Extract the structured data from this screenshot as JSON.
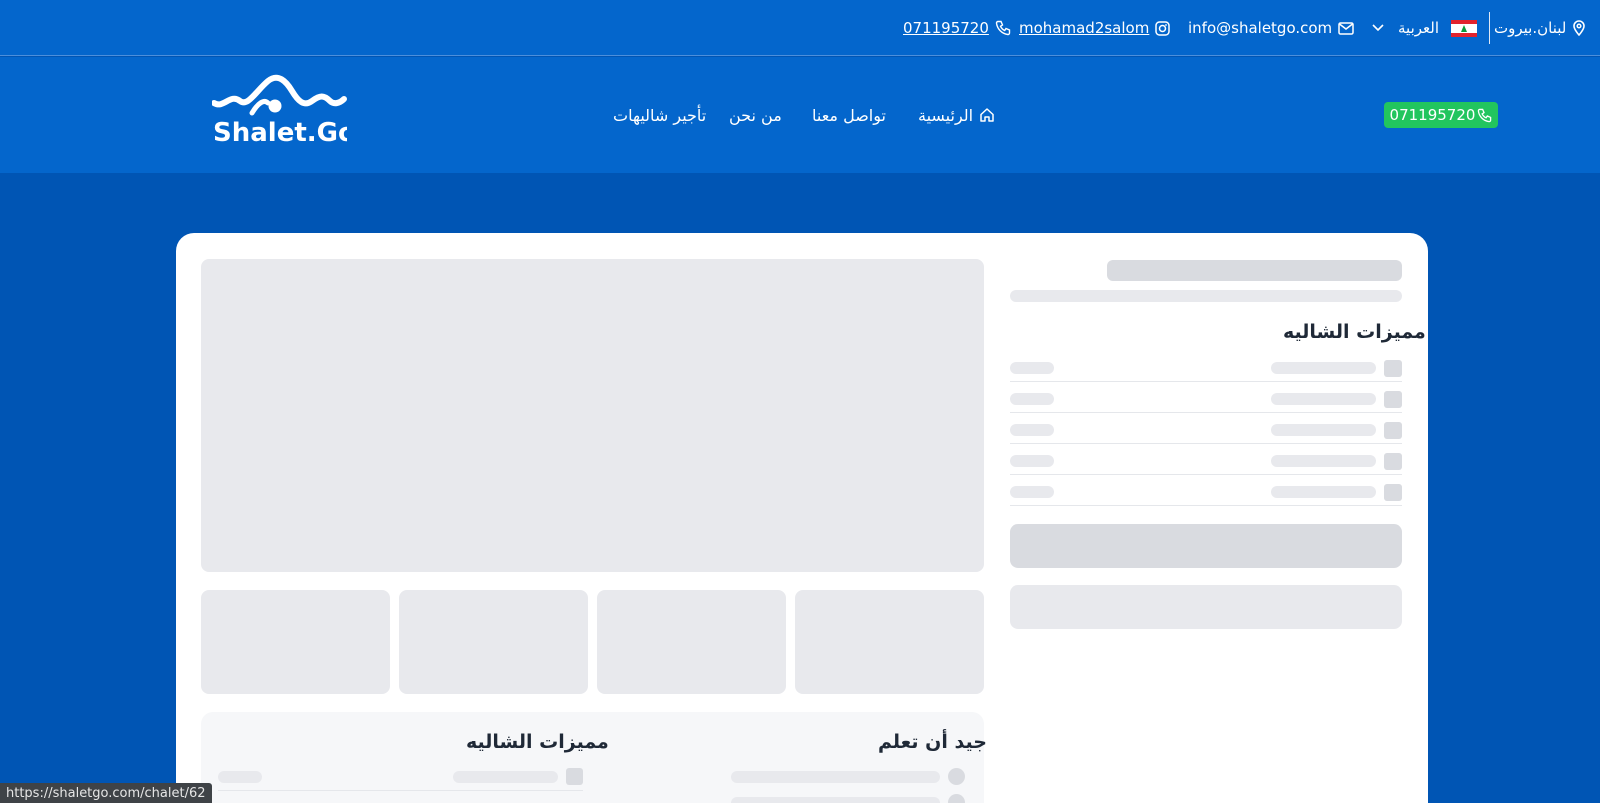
{
  "topbar": {
    "location": "لبنان.بيروت",
    "language": "العربية",
    "email": "info@shaletgo.com",
    "instagram": "mohamad2salom",
    "phone": "071195720"
  },
  "header": {
    "logo_text": "Shalet.Go",
    "nav": {
      "home": "الرئيسية",
      "contact": "تواصل معنا",
      "about": "من نحن",
      "rent": "تأجير شاليهات"
    },
    "call_button": "071195720"
  },
  "content": {
    "features_title": "مميزات الشاليه",
    "good_to_know_title": "جيد أن تعلم",
    "features_title_bottom": "مميزات الشاليه"
  },
  "statusbar": {
    "url": "https://shaletgo.com/chalet/62"
  },
  "colors": {
    "topbar": "#0466cc",
    "background": "#0055b4",
    "call_button": "#22c55e"
  }
}
